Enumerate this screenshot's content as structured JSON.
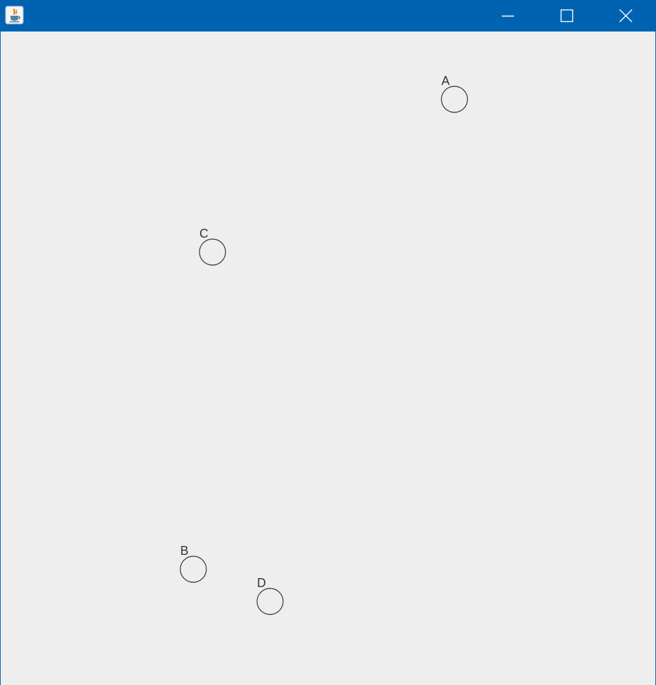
{
  "window": {
    "title": "",
    "icon": "java-cup-icon",
    "controls": {
      "minimize": "minimize-icon",
      "maximize": "maximize-icon",
      "close": "close-icon"
    }
  },
  "colors": {
    "titlebar": "#0063b1",
    "canvas_background": "#eeeeee",
    "stroke": "#333333"
  },
  "nodes": [
    {
      "label": "A"
    },
    {
      "label": "C"
    },
    {
      "label": "B"
    },
    {
      "label": "D"
    }
  ]
}
